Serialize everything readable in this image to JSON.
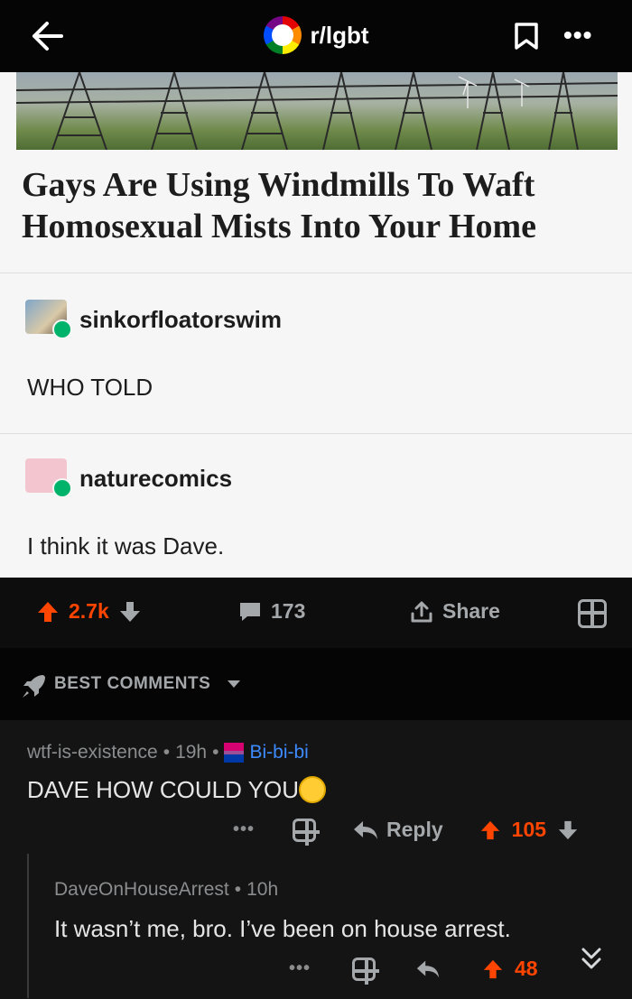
{
  "header": {
    "subreddit": "r/lgbt",
    "back_icon": "arrow-left-icon",
    "bookmark_icon": "bookmark-icon",
    "more_icon": "more-dots-icon"
  },
  "post": {
    "headline_line1": "Gays Are Using Windmills To Waft",
    "headline_line2": "Homosexual Mists Into Your Home",
    "tumblr_posts": [
      {
        "username": "sinkorfloatorswim",
        "text": "WHO TOLD"
      },
      {
        "username": "naturecomics",
        "text": "I think it was Dave."
      }
    ]
  },
  "actions": {
    "votes": "2.7k",
    "comments": "173",
    "share_label": "Share"
  },
  "sort": {
    "label": "BEST COMMENTS"
  },
  "comments": [
    {
      "author": "wtf-is-existence",
      "age": "19h",
      "flair": "Bi-bi-bi",
      "text": "DAVE HOW COULD YOU",
      "reply_label": "Reply",
      "score": "105"
    },
    {
      "author": "DaveOnHouseArrest",
      "age": "10h",
      "text": "It wasn’t me, bro. I’ve been on house arrest.",
      "score": "48"
    }
  ],
  "colors": {
    "upvote": "#ff4500",
    "flair": "#3d8bff",
    "background": "#141414"
  }
}
